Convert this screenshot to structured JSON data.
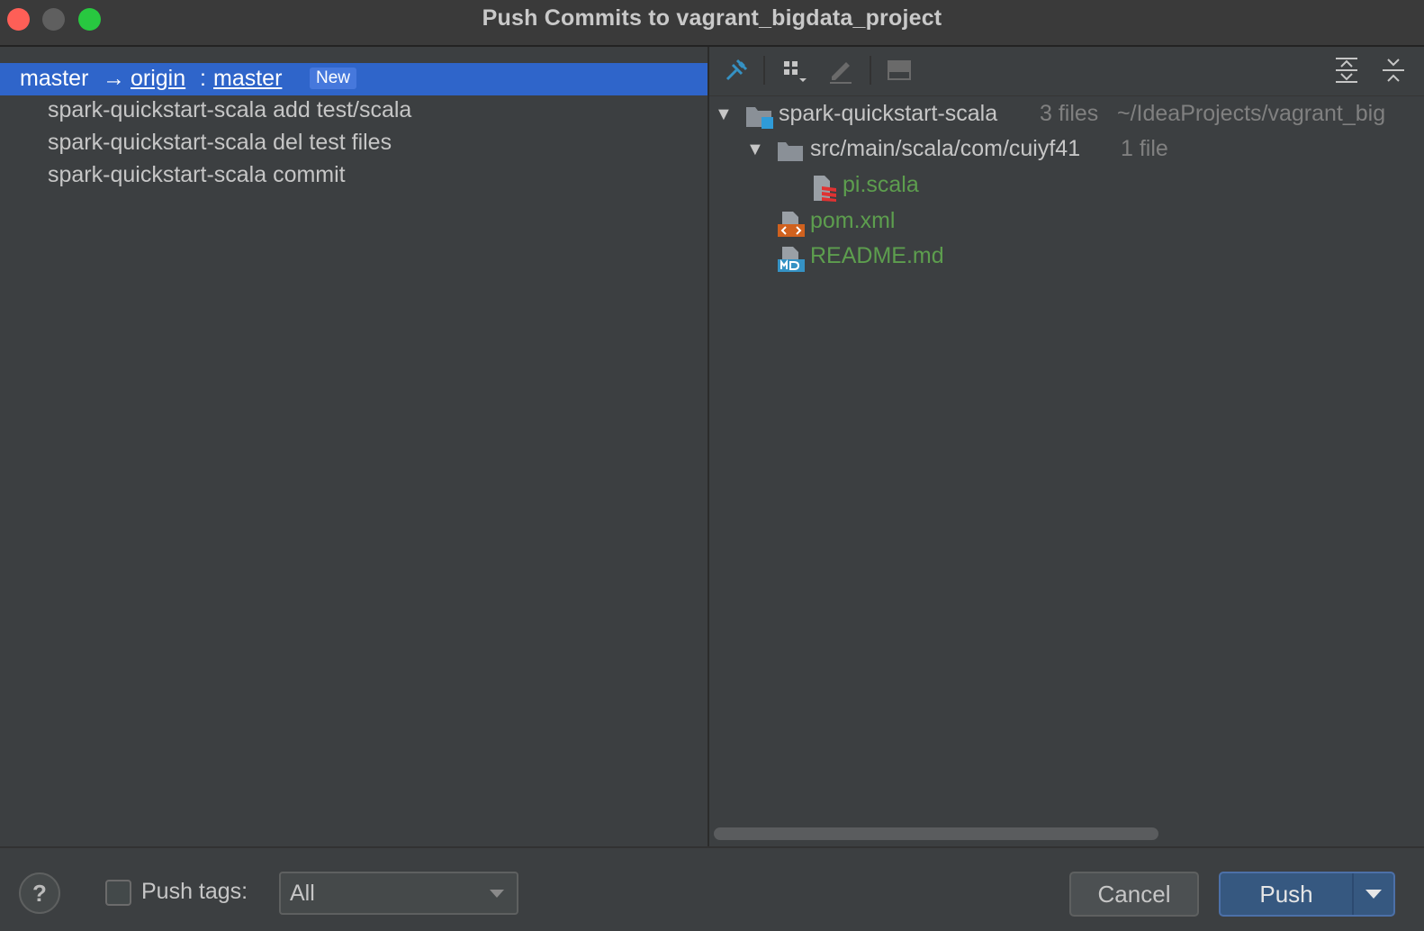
{
  "window": {
    "title": "Push Commits to vagrant_bigdata_project"
  },
  "push_target": {
    "local_branch": "master",
    "arrow": "→",
    "remote": "origin",
    "separator": ":",
    "remote_branch": "master",
    "badge": "New"
  },
  "commits": [
    "spark-quickstart-scala add test/scala",
    "spark-quickstart-scala del test files",
    "spark-quickstart-scala commit"
  ],
  "toolbar_icons": [
    "pin-icon",
    "group-by-icon",
    "edit-icon",
    "preview-icon",
    "expand-all-icon",
    "collapse-all-icon"
  ],
  "file_tree": {
    "root": {
      "name": "spark-quickstart-scala",
      "count": "3 files",
      "path": "~/IdeaProjects/vagrant_big"
    },
    "folder": {
      "name": "src/main/scala/com/cuiyf41",
      "count": "1 file"
    },
    "files": [
      {
        "name": "pi.scala",
        "icon": "scala-file-icon"
      },
      {
        "name": "pom.xml",
        "icon": "xml-file-icon"
      },
      {
        "name": "README.md",
        "icon": "markdown-file-icon"
      }
    ],
    "new_file_color": "#5d9e4e"
  },
  "bottom": {
    "help": "?",
    "push_tags_label": "Push tags:",
    "push_tags_checked": false,
    "push_tags_value": "All",
    "cancel_label": "Cancel",
    "push_label": "Push"
  },
  "colors": {
    "selection": "#2f65ca",
    "push_button": "#365880"
  }
}
